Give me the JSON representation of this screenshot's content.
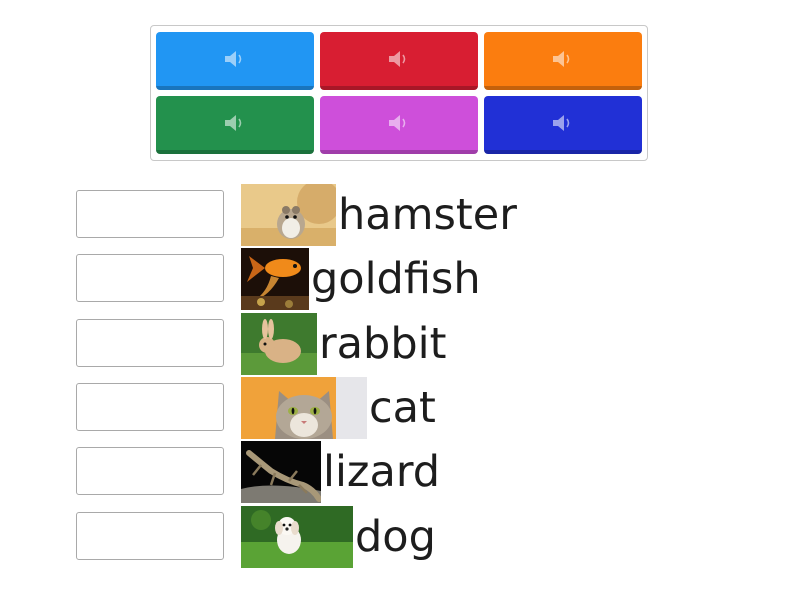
{
  "tiles": [
    {
      "name": "audio-tile-blue",
      "color": "#2196f3",
      "icon": "speaker-icon"
    },
    {
      "name": "audio-tile-red",
      "color": "#d81e32",
      "icon": "speaker-icon"
    },
    {
      "name": "audio-tile-orange",
      "color": "#fb7d0f",
      "icon": "speaker-icon"
    },
    {
      "name": "audio-tile-green",
      "color": "#23914d",
      "icon": "speaker-icon"
    },
    {
      "name": "audio-tile-purple",
      "color": "#ce4fda",
      "icon": "speaker-icon"
    },
    {
      "name": "audio-tile-navy",
      "color": "#2130d6",
      "icon": "speaker-icon"
    }
  ],
  "items": [
    {
      "word": "hamster",
      "image": "hamster-image"
    },
    {
      "word": "goldfish",
      "image": "goldfish-image"
    },
    {
      "word": "rabbit",
      "image": "rabbit-image"
    },
    {
      "word": "cat",
      "image": "cat-image"
    },
    {
      "word": "lizard",
      "image": "lizard-image"
    },
    {
      "word": "dog",
      "image": "dog-image"
    }
  ]
}
